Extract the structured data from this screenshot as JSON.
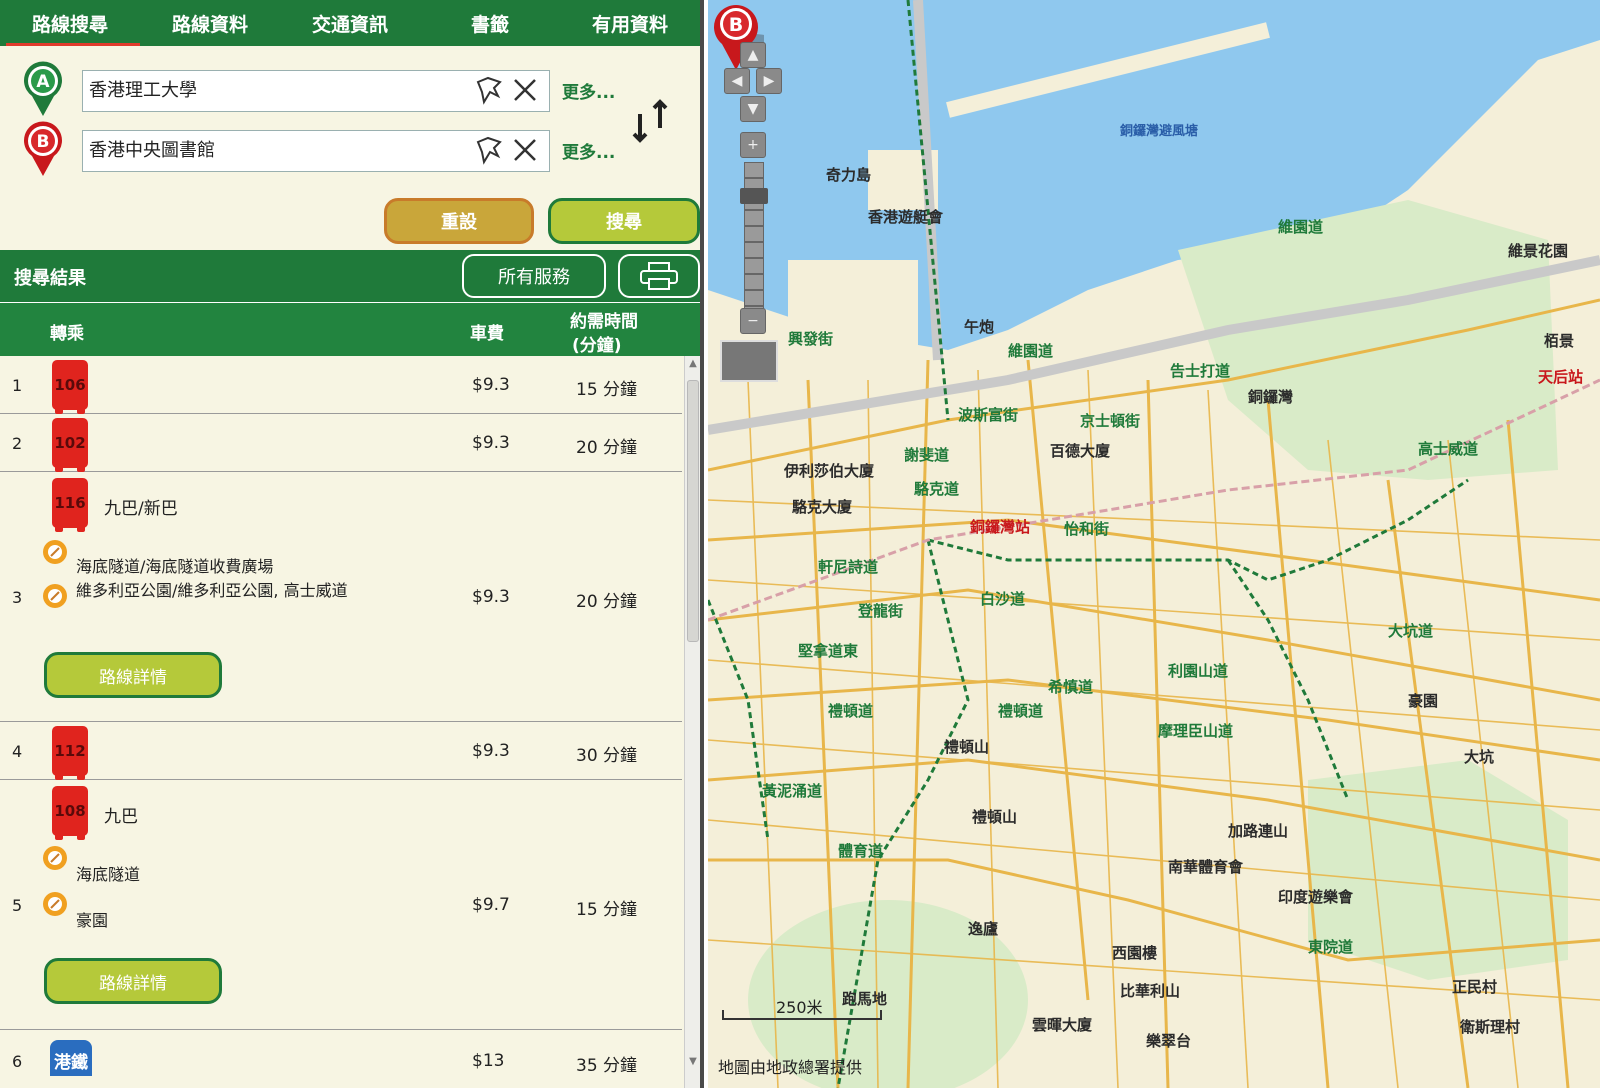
{
  "nav": {
    "tabs": [
      "路線搜尋",
      "路線資料",
      "交通資訊",
      "書籤",
      "有用資料"
    ]
  },
  "origin": {
    "value": "香港理工大學",
    "more": "更多..."
  },
  "destination": {
    "value": "香港中央圖書館",
    "more": "更多..."
  },
  "buttons": {
    "reset": "重設",
    "search": "搜尋"
  },
  "results": {
    "title": "搜尋結果",
    "all_services": "所有服務"
  },
  "columns": {
    "transfer": "轉乘",
    "fare": "車費",
    "time_line1": "約需時間",
    "time_line2": "(分鐘)"
  },
  "detail_label": "路線詳情",
  "rows": [
    {
      "num": "1",
      "route": "106",
      "fare": "$9.3",
      "time": "15 分鐘"
    },
    {
      "num": "2",
      "route": "102",
      "fare": "$9.3",
      "time": "20 分鐘"
    },
    {
      "num": "3",
      "route": "116",
      "operator": "九巴/新巴",
      "stop1": "海底隧道/海底隧道收費廣場",
      "stop2": "維多利亞公園/維多利亞公園, 高士威道",
      "fare": "$9.3",
      "time": "20 分鐘"
    },
    {
      "num": "4",
      "route": "112",
      "fare": "$9.3",
      "time": "30 分鐘"
    },
    {
      "num": "5",
      "route": "108",
      "operator": "九巴",
      "stop1": "海底隧道",
      "stop2": "豪園",
      "fare": "$9.7",
      "time": "15 分鐘"
    },
    {
      "num": "6",
      "route": "港鐵",
      "fare": "$13",
      "time": "35 分鐘"
    }
  ],
  "map": {
    "labels": {
      "typhoon_shelter": "銅鑼灣避風塘",
      "kellett": "奇力島",
      "yacht_club": "香港遊艇會",
      "gloucester_rd": "告士打道",
      "victoria_rd": "維園道",
      "noonday_gun": "午炮",
      "hing_fat": "興發街",
      "causeway_bay": "銅鑼灣",
      "kingston": "京士頓街",
      "paterson": "百德大廈",
      "elizabeth": "伊利莎伯大廈",
      "percival": "波斯富街",
      "lockhart": "駱克道",
      "lockhart_house": "駱克大廈",
      "cwb_station": "銅鑼灣站",
      "yee_wo": "怡和街",
      "jaffe": "謝斐道",
      "pak_sha": "白沙道",
      "hennessy": "軒尼詩道",
      "matheson": "登龍街",
      "canal_rd": "堅拿道東",
      "leighton": "利園山道",
      "tai_hang": "大坑道",
      "haoyuan": "豪園",
      "taihang_area": "大坑",
      "causeway_rd": "高士威道",
      "caroline": "加路連山",
      "south_china": "南華體育會",
      "indian_rec": "印度遊樂會",
      "tungwah": "東院道",
      "ching_man": "正民村",
      "sze_lei": "衛斯理村",
      "happy_valley": "跑馬地",
      "vega": "比華利山",
      "wun_sha": "雲暉大廈",
      "tsui_tsui": "樂翠台",
      "western": "西園樓",
      "yat_ming": "逸廬",
      "lee_garden": "禮頓山",
      "lee_garden2": "禮頓山",
      "vistaview": "維景花園",
      "tin_hau": "天后站",
      "pak_king": "栢景",
      "victoria_park_rd": "維園道",
      "kwong_wah": "禮頓道",
      "hysan": "希慎道",
      "sports_rd": "體育道",
      "wong_nai_chung": "黃泥涌道",
      "morrison": "摩理臣山道",
      "gap_rd": "禮頓道"
    },
    "scale": "250米",
    "credit": "地圖由地政總署提供",
    "marker_label": "B"
  }
}
